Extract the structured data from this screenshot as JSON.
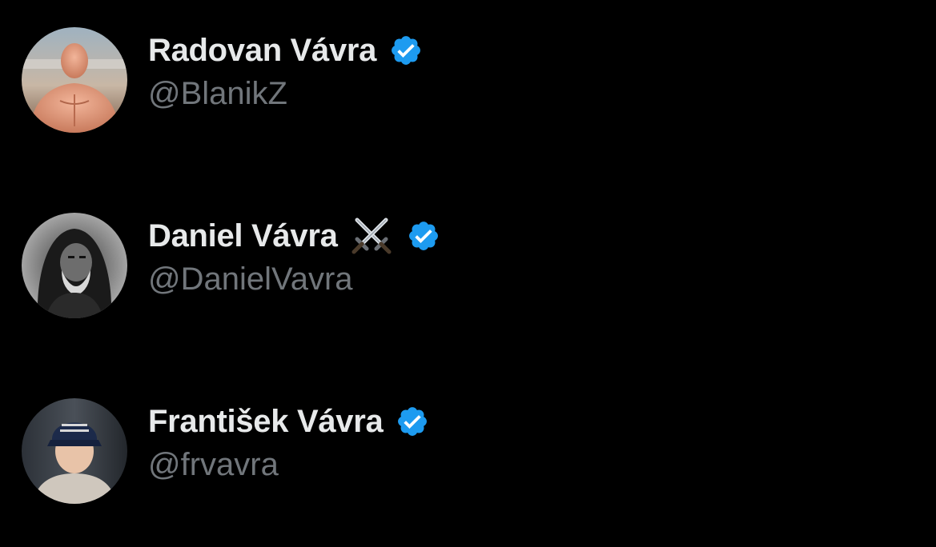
{
  "colors": {
    "background": "#000000",
    "name_text": "#e7e9ea",
    "handle_text": "#71767b",
    "verified_blue": "#1d9bf0"
  },
  "users": [
    {
      "display_name": "Radovan Vávra",
      "handle": "@BlanikZ",
      "emoji": "",
      "verified": true,
      "verified_icon": "verified-badge-icon",
      "avatar_icon": "avatar-shirtless-man-photo"
    },
    {
      "display_name": "Daniel Vávra",
      "handle": "@DanielVavra",
      "emoji": "⚔️",
      "emoji_icon": "crossed-swords-icon",
      "verified": true,
      "verified_icon": "verified-badge-icon",
      "avatar_icon": "avatar-hooded-bearded-man-photo"
    },
    {
      "display_name": "František Vávra",
      "handle": "@frvavra",
      "emoji": "",
      "verified": true,
      "verified_icon": "verified-badge-icon",
      "avatar_icon": "avatar-man-in-cap-photo"
    }
  ]
}
